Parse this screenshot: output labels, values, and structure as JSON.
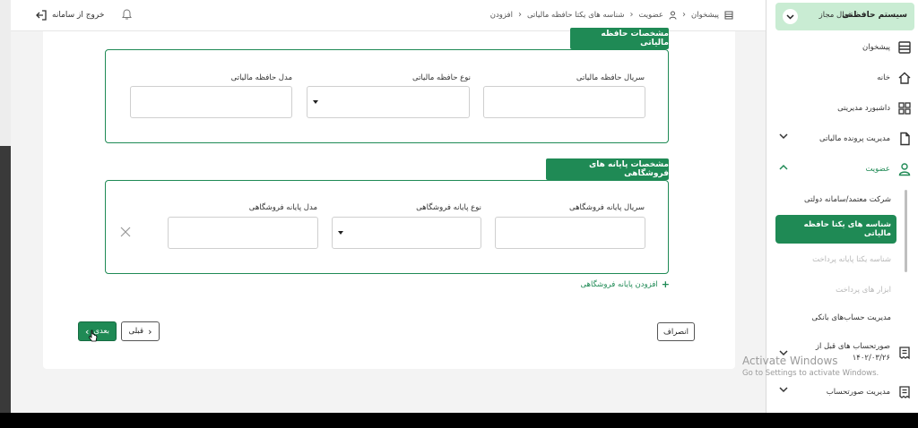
{
  "topbar": {
    "logout_label": "خروج از سامانه",
    "breadcrumb": [
      "پیشخوان",
      "عضویت",
      "شناسه های یکتا حافظه مالیاتی",
      "افزودن"
    ]
  },
  "section1": {
    "title": "مشخصات حافظه مالیاتی",
    "fields": [
      {
        "label": "سریال حافظه مالیاتی",
        "value": ""
      },
      {
        "label": "نوع حافظه مالیاتی",
        "value": ""
      },
      {
        "label": "مدل حافظه مالیاتی",
        "value": ""
      }
    ]
  },
  "section2": {
    "title": "مشخصات پایانه های فروشگاهی",
    "fields": [
      {
        "label": "سریال پایانه فروشگاهی",
        "value": ""
      },
      {
        "label": "نوع پایانه فروشگاهی",
        "value": ""
      },
      {
        "label": "مدل پایانه فروشگاهی",
        "value": ""
      }
    ],
    "add_label": "افزودن پایانه فروشگاهی"
  },
  "actions": {
    "cancel": "انصراف",
    "prev": "قبلی",
    "next": "بعدی"
  },
  "sidebar": {
    "system_name": "سیستم حافظتی",
    "status": "فعال مجاز",
    "items": [
      {
        "label": "پیشخوان",
        "icon": "dashboard-icon"
      },
      {
        "label": "خانه",
        "icon": "home-icon"
      },
      {
        "label": "داشبورد مدیریتی",
        "icon": "grid-icon"
      },
      {
        "label": "مدیریت پرونده مالیاتی",
        "icon": "file-icon"
      },
      {
        "label": "عضویت",
        "icon": "user-icon"
      }
    ],
    "submenu": [
      {
        "label": "شرکت معتمد/سامانه دولتی",
        "disabled": false
      },
      {
        "label": "شناسه های یکتا حافظه مالیاتی",
        "active": true
      },
      {
        "label": "شناسه یکتا پایانه پرداخت",
        "disabled": true
      },
      {
        "label": "ابزار های پرداخت",
        "disabled": true
      },
      {
        "label": "مدیریت حساب‌های بانکی",
        "disabled": false
      }
    ],
    "more_items": [
      {
        "label": "صورتحساب های قبل از",
        "label2": "۱۴۰۲/۰۳/۲۶",
        "icon": "receipt-icon"
      },
      {
        "label": "مدیریت صورتحساب",
        "icon": "receipt-icon"
      }
    ]
  },
  "watermark": {
    "line1": "Activate Windows",
    "line2": "Go to Settings to activate Windows."
  },
  "colors": {
    "primary": "#1f8a55",
    "primary_light": "#c9ecd3"
  }
}
